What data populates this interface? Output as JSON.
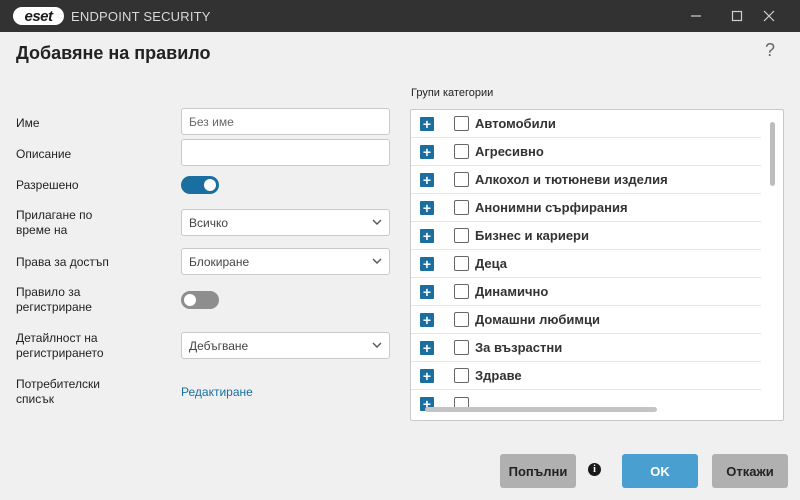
{
  "app": {
    "logo_text": "eset",
    "title": "ENDPOINT SECURITY",
    "icons": {
      "minimize": "minimize-icon",
      "maximize": "maximize-icon",
      "close": "close-icon"
    }
  },
  "dialog": {
    "title": "Добавяне на правило",
    "help": "?"
  },
  "form": {
    "name_label": "Име",
    "name_placeholder": "Без име",
    "description_label": "Описание",
    "description_value": "",
    "enabled_label": "Разрешено",
    "enabled": true,
    "apply_time_label_1": "Прилагане по",
    "apply_time_label_2": "време на",
    "apply_time_value": "Всичко",
    "access_label": "Права за достъп",
    "access_value": "Блокиране",
    "logging_label_1": "Правило за",
    "logging_label_2": "регистриране",
    "logging_enabled": false,
    "verbosity_label_1": "Детайлност на",
    "verbosity_label_2": "регистрирането",
    "verbosity_value": "Дебъгване",
    "user_list_label_1": "Потребителски",
    "user_list_label_2": "списък",
    "edit_link": "Редактиране"
  },
  "categories": {
    "header": "Групи категории",
    "items": [
      {
        "label": "Автомобили",
        "checked": false
      },
      {
        "label": "Агресивно",
        "checked": false
      },
      {
        "label": "Алкохол и тютюневи изделия",
        "checked": false
      },
      {
        "label": "Анонимни сърфирания",
        "checked": false
      },
      {
        "label": "Бизнес и кариери",
        "checked": false
      },
      {
        "label": "Деца",
        "checked": false
      },
      {
        "label": "Динамично",
        "checked": false
      },
      {
        "label": "Домашни любимци",
        "checked": false
      },
      {
        "label": "За възрастни",
        "checked": false
      },
      {
        "label": "Здраве",
        "checked": false
      }
    ]
  },
  "buttons": {
    "populate": "Попълни",
    "ok": "OK",
    "cancel": "Откажи"
  },
  "colors": {
    "accent": "#1a6fa0",
    "ok_button": "#4a9fd1",
    "titlebar": "#323232"
  }
}
